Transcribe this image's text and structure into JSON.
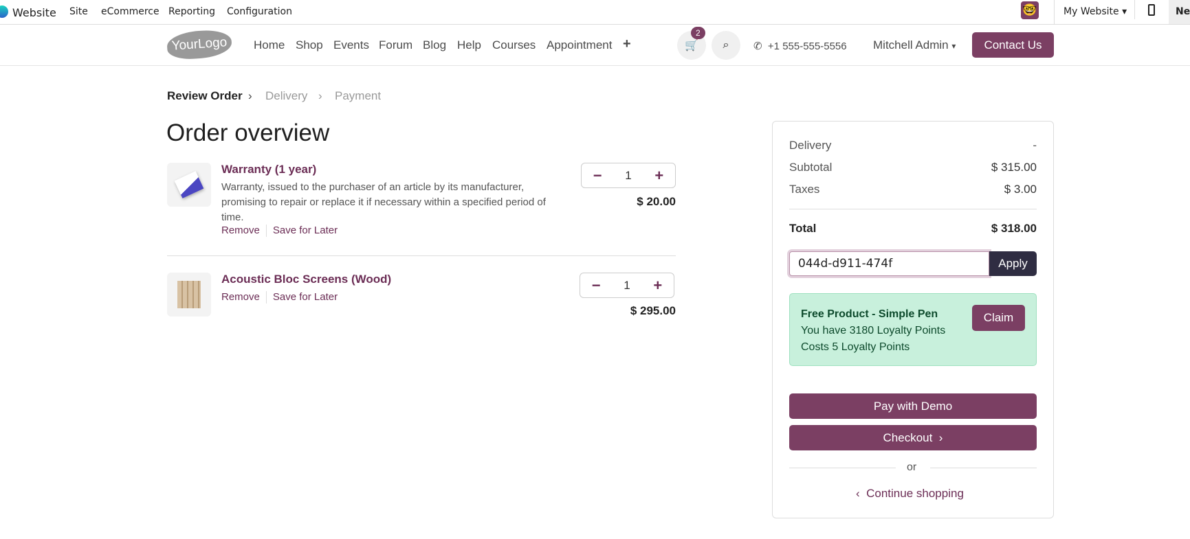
{
  "topbar": {
    "app": "Website",
    "menus": [
      "Site",
      "eCommerce",
      "Reporting",
      "Configuration"
    ],
    "website_selector": "My Website",
    "new_label": "Ne"
  },
  "nav": {
    "logo": "YourLogo",
    "links": [
      "Home",
      "Shop",
      "Events",
      "Forum",
      "Blog",
      "Help",
      "Courses",
      "Appointment"
    ],
    "cart_count": "2",
    "phone": "+1 555-555-5556",
    "user": "Mitchell Admin",
    "contact": "Contact Us"
  },
  "breadcrumb": [
    "Review Order",
    "Delivery",
    "Payment"
  ],
  "title": "Order overview",
  "items": [
    {
      "name": "Warranty (1 year)",
      "description": "Warranty, issued to the purchaser of an article by its manufacturer, promising to repair or replace it if necessary within a specified period of time.",
      "qty": "1",
      "price": "$ 20.00",
      "remove": "Remove",
      "save": "Save for Later"
    },
    {
      "name": "Acoustic Bloc Screens (Wood)",
      "qty": "1",
      "price": "$ 295.00",
      "remove": "Remove",
      "save": "Save for Later"
    }
  ],
  "summary": {
    "delivery_label": "Delivery",
    "delivery": "-",
    "subtotal_label": "Subtotal",
    "subtotal": "$ 315.00",
    "taxes_label": "Taxes",
    "taxes": "$ 3.00",
    "total_label": "Total",
    "total": "$ 318.00",
    "promo_value": "044d-d911-474f",
    "apply": "Apply",
    "reward": {
      "title": "Free Product - Simple Pen",
      "points": "You have 3180 Loyalty Points",
      "cost": "Costs 5 Loyalty Points",
      "claim": "Claim"
    },
    "pay": "Pay with Demo",
    "checkout": "Checkout",
    "or": "or",
    "continue": "Continue shopping"
  }
}
